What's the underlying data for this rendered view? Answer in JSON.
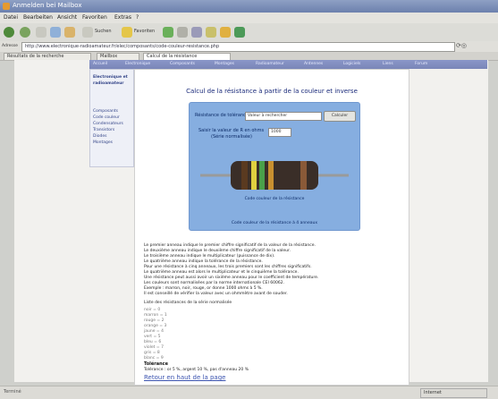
{
  "window": {
    "title": "Anmelden bei Mailbox"
  },
  "menu": [
    "Datei",
    "Bearbeiten",
    "Ansicht",
    "Favoriten",
    "Extras",
    "?"
  ],
  "toolbar": {
    "search_label": "Suchen",
    "favorites_label": "Favoriten"
  },
  "address": {
    "label": "Adresse",
    "url": "http://www.electronique-radioamateur.fr/elec/composants/code-couleur-resistance.php"
  },
  "tabs": [
    {
      "label": "Résultats de la recherche"
    },
    {
      "label": "Mailbox"
    },
    {
      "label": "Calcul de la résistance"
    }
  ],
  "linkbar": [
    "Accueil",
    "Electronique",
    "Composants",
    "Montages",
    "Radioamateur",
    "Antennes",
    "Logiciels",
    "Liens",
    "Forum"
  ],
  "sidebar": [
    "Electronique et",
    "radioamateur",
    "",
    "Composants",
    "Code couleur",
    "Condensateurs",
    "Transistors",
    "Diodes",
    "Montages"
  ],
  "page": {
    "title": "Calcul de la résistance à partir de la couleur et inverse",
    "calc": {
      "label_select": "Résistance de tolérance",
      "select_value": "Valeur à rechercher",
      "button": "Calculer",
      "label_value": "Saisir la valeur de R en ohms",
      "label_value2": "(Série normalisée)",
      "value": "1000",
      "caption": "Code couleur de la résistance",
      "footnote": "Code couleur de la résistance à 4 anneaux"
    },
    "paragraphs": [
      "Le premier anneau indique le premier chiffre significatif de la valeur de la résistance.",
      "Le deuxième anneau indique le deuxième chiffre significatif de la valeur.",
      "Le troisième anneau indique le multiplicateur (puissance de dix).",
      "Le quatrième anneau indique la tolérance de la résistance.",
      "Pour une résistance à cinq anneaux, les trois premiers sont les chiffres significatifs.",
      "Le quatrième anneau est alors le multiplicateur et le cinquième la tolérance.",
      "Une résistance peut aussi avoir un sixième anneau pour le coefficient de température.",
      "Les couleurs sont normalisées par la norme internationale CEI 60062.",
      "Exemple : marron, noir, rouge, or donne 1000 ohms à 5 %.",
      "Il est conseillé de vérifier la valeur avec un ohmmètre avant de souder."
    ],
    "subtitle": "Liste des résistances de la série normalisée",
    "values": [
      "noir = 0",
      "marron = 1",
      "rouge = 2",
      "orange = 3",
      "jaune = 4",
      "vert = 5",
      "bleu = 6",
      "violet = 7",
      "gris = 8",
      "blanc = 9"
    ],
    "bold_label": "Tolérance",
    "bold_text": "Tolérance : or 5 %, argent 10 %, pas d'anneau 20 %",
    "bottom_link": "Retour en haut de la page"
  },
  "status": {
    "left": "Terminé",
    "right": "Internet"
  },
  "colors": {
    "calc_box": "#86aee0",
    "linkbar": "#8a96c8",
    "title_blue": "#1a2a7a"
  }
}
